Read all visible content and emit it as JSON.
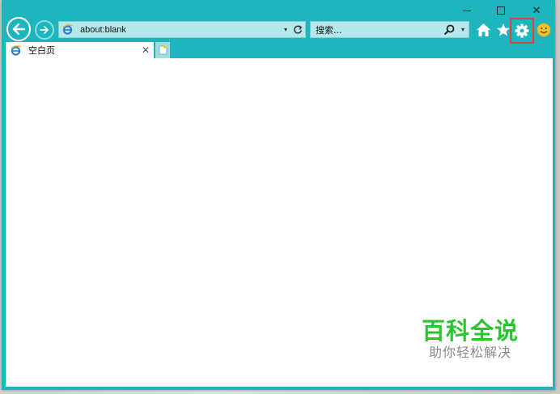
{
  "window": {
    "caption_minimize": "—",
    "caption_maximize": "☐",
    "caption_close": "✕"
  },
  "address": {
    "value": "about:blank",
    "dropdown_glyph": "▾"
  },
  "search": {
    "placeholder": "搜索...",
    "dropdown_glyph": "▾"
  },
  "tabs": [
    {
      "title": "空白页",
      "close_glyph": "✕"
    }
  ],
  "watermark": {
    "title": "百科全说",
    "subtitle": "助你轻松解决"
  },
  "colors": {
    "chrome": "#1fb5bd",
    "field": "#b5e8eb",
    "highlight": "#d9453b",
    "brand_green": "#2bc42f"
  },
  "icons": {
    "back": "back-arrow-icon",
    "forward": "forward-arrow-icon",
    "ie": "ie-logo-icon",
    "refresh": "refresh-icon",
    "search": "search-icon",
    "home": "home-icon",
    "favorites": "star-icon",
    "tools": "gear-icon",
    "feedback": "smiley-icon",
    "new_tab": "new-tab-icon"
  }
}
